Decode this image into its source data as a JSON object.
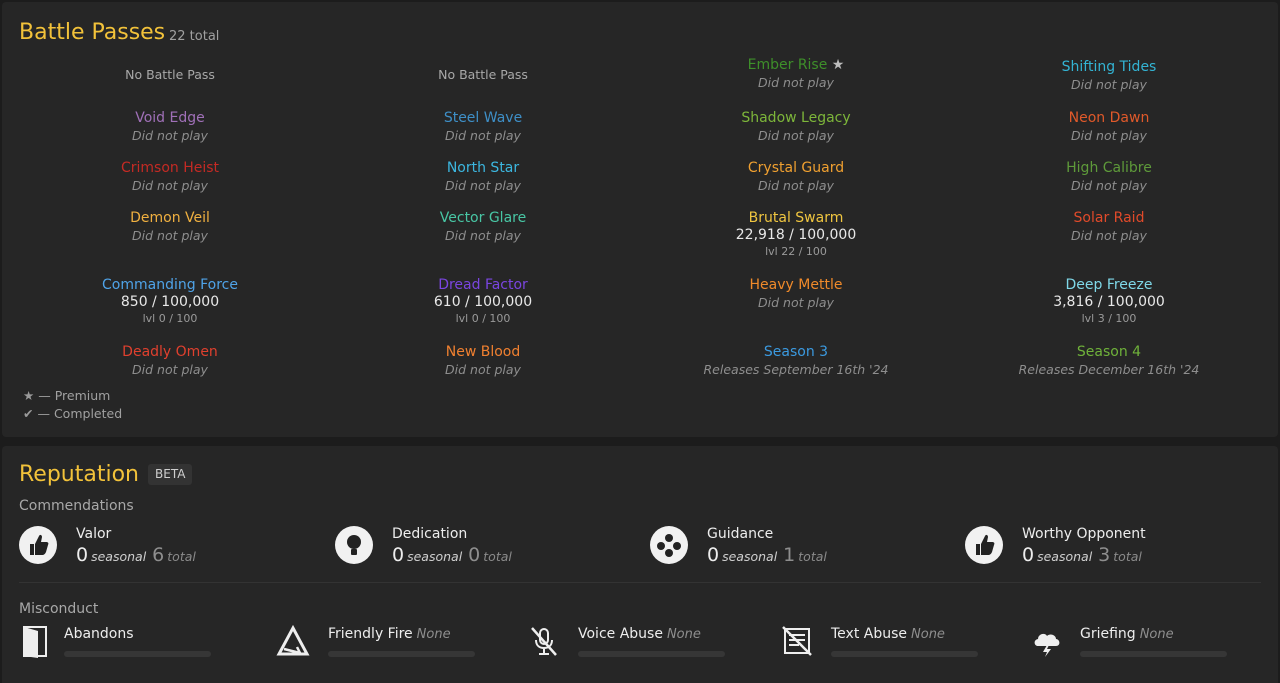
{
  "battle_passes": {
    "title": "Battle Passes",
    "total": "22 total",
    "items": [
      {
        "name": "",
        "status": "",
        "none": "No Battle Pass"
      },
      {
        "name": "",
        "status": "",
        "none": "No Battle Pass"
      },
      {
        "name": "Ember Rise",
        "star": "★",
        "status": "Did not play",
        "color": "#3e8f2a"
      },
      {
        "name": "Shifting Tides",
        "status": "Did not play",
        "color": "#33b4d4"
      },
      {
        "name": "Void Edge",
        "status": "Did not play",
        "color": "#a070b8"
      },
      {
        "name": "Steel Wave",
        "status": "Did not play",
        "color": "#3e8fc7"
      },
      {
        "name": "Shadow Legacy",
        "status": "Did not play",
        "color": "#7db63a"
      },
      {
        "name": "Neon Dawn",
        "status": "Did not play",
        "color": "#e0592a"
      },
      {
        "name": "Crimson Heist",
        "status": "Did not play",
        "color": "#c42a24"
      },
      {
        "name": "North Star",
        "status": "Did not play",
        "color": "#3cb7e0"
      },
      {
        "name": "Crystal Guard",
        "status": "Did not play",
        "color": "#f0a030"
      },
      {
        "name": "High Calibre",
        "status": "Did not play",
        "color": "#5e9a3a"
      },
      {
        "name": "Demon Veil",
        "status": "Did not play",
        "color": "#f0b040"
      },
      {
        "name": "Vector Glare",
        "status": "Did not play",
        "color": "#48c6a4"
      },
      {
        "name": "Brutal Swarm",
        "progress": "22,918 / 100,000",
        "level": "lvl 22 / 100",
        "color": "#f0c640"
      },
      {
        "name": "Solar Raid",
        "status": "Did not play",
        "color": "#e04a2a"
      },
      {
        "name": "Commanding Force",
        "progress": "850 / 100,000",
        "level": "lvl 0 / 100",
        "color": "#4fa3e8"
      },
      {
        "name": "Dread Factor",
        "progress": "610 / 100,000",
        "level": "lvl 0 / 100",
        "color": "#7a45e0"
      },
      {
        "name": "Heavy Mettle",
        "status": "Did not play",
        "color": "#f08a2a"
      },
      {
        "name": "Deep Freeze",
        "progress": "3,816 / 100,000",
        "level": "lvl 3 / 100",
        "color": "#7fd8e8"
      },
      {
        "name": "Deadly Omen",
        "status": "Did not play",
        "color": "#e0402e"
      },
      {
        "name": "New Blood",
        "status": "Did not play",
        "color": "#f08030"
      },
      {
        "name": "Season 3",
        "status": "Releases September 16th '24",
        "color": "#3b9ae0"
      },
      {
        "name": "Season 4",
        "status": "Releases December 16th '24",
        "color": "#6fb23a"
      }
    ],
    "legend": {
      "premium": "— Premium",
      "completed": "— Completed",
      "premium_glyph": "★",
      "completed_glyph": "✔"
    }
  },
  "reputation": {
    "title": "Reputation",
    "badge": "BETA",
    "commendations_label": "Commendations",
    "commendations": [
      {
        "name": "Valor",
        "seasonal": "0",
        "seasonal_label": "seasonal",
        "total": "6",
        "total_label": "total",
        "icon": "thumbs-up-icon"
      },
      {
        "name": "Dedication",
        "seasonal": "0",
        "seasonal_label": "seasonal",
        "total": "0",
        "total_label": "total",
        "icon": "lightbulb-icon"
      },
      {
        "name": "Guidance",
        "seasonal": "0",
        "seasonal_label": "seasonal",
        "total": "1",
        "total_label": "total",
        "icon": "group-icon"
      },
      {
        "name": "Worthy Opponent",
        "seasonal": "0",
        "seasonal_label": "seasonal",
        "total": "3",
        "total_label": "total",
        "icon": "thumbs-up-icon"
      }
    ],
    "misconduct_label": "Misconduct",
    "misconduct": [
      {
        "name": "Abandons",
        "value": "",
        "icon": "door-exit-icon"
      },
      {
        "name": "Friendly Fire",
        "value": "None",
        "icon": "triangle-arrow-icon"
      },
      {
        "name": "Voice Abuse",
        "value": "None",
        "icon": "mic-muted-icon"
      },
      {
        "name": "Text Abuse",
        "value": "None",
        "icon": "text-blocked-icon"
      },
      {
        "name": "Griefing",
        "value": "None",
        "icon": "storm-cloud-icon"
      }
    ]
  }
}
